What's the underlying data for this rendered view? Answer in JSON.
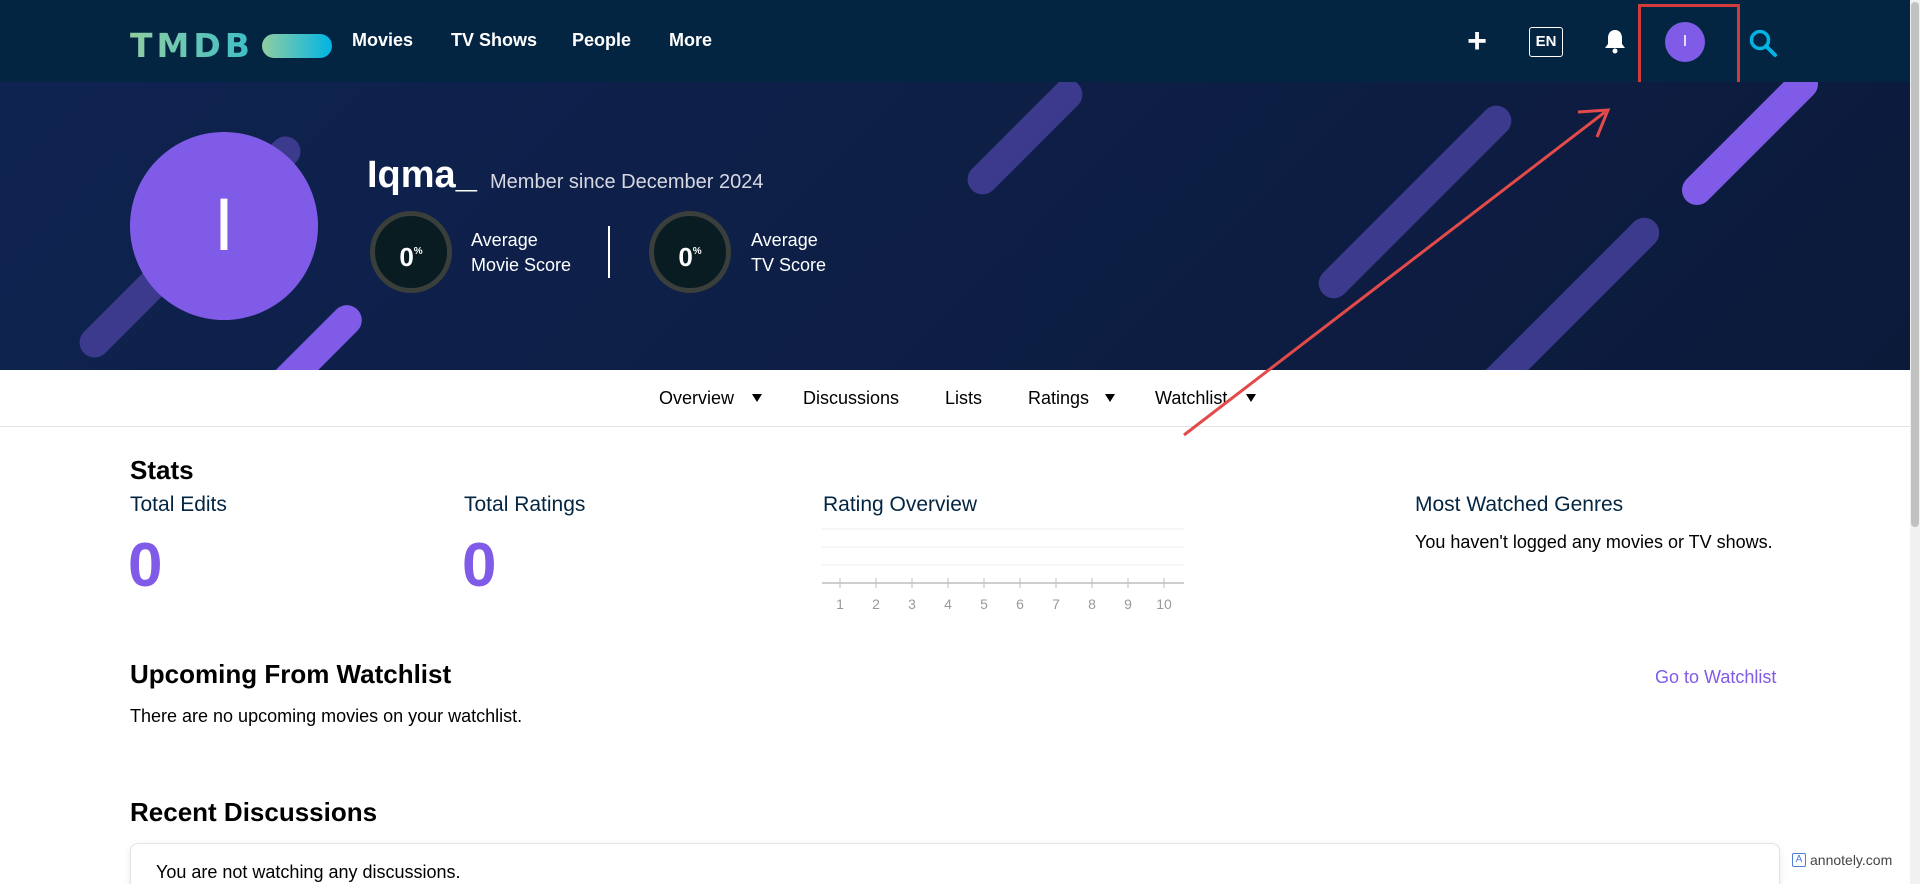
{
  "nav": {
    "logo_text": "TMDB",
    "links": [
      "Movies",
      "TV Shows",
      "People",
      "More"
    ],
    "lang": "EN",
    "avatar_initial": "I",
    "colors": {
      "bar": "#032541",
      "avatar": "#805be7",
      "search": "#01b4e4"
    }
  },
  "hero": {
    "avatar_initial": "I",
    "username": "Iqma_",
    "member_since": "Member since December 2024",
    "scores": [
      {
        "value": "0",
        "unit": "%",
        "label_line1": "Average",
        "label_line2": "Movie Score"
      },
      {
        "value": "0",
        "unit": "%",
        "label_line1": "Average",
        "label_line2": "TV Score"
      }
    ]
  },
  "tabs": [
    "Overview",
    "Discussions",
    "Lists",
    "Ratings",
    "Watchlist"
  ],
  "stats": {
    "heading": "Stats",
    "total_edits_label": "Total Edits",
    "total_edits_value": "0",
    "total_ratings_label": "Total Ratings",
    "total_ratings_value": "0",
    "rating_overview_label": "Rating Overview",
    "rating_ticks": [
      "1",
      "2",
      "3",
      "4",
      "5",
      "6",
      "7",
      "8",
      "9",
      "10"
    ],
    "genres_label": "Most Watched Genres",
    "genres_empty": "You haven't logged any movies or TV shows."
  },
  "upcoming": {
    "heading": "Upcoming From Watchlist",
    "link": "Go to Watchlist",
    "empty": "There are no upcoming movies on your watchlist."
  },
  "discussions": {
    "heading": "Recent Discussions",
    "empty": "You are not watching any discussions."
  },
  "watermark": "annotely.com"
}
